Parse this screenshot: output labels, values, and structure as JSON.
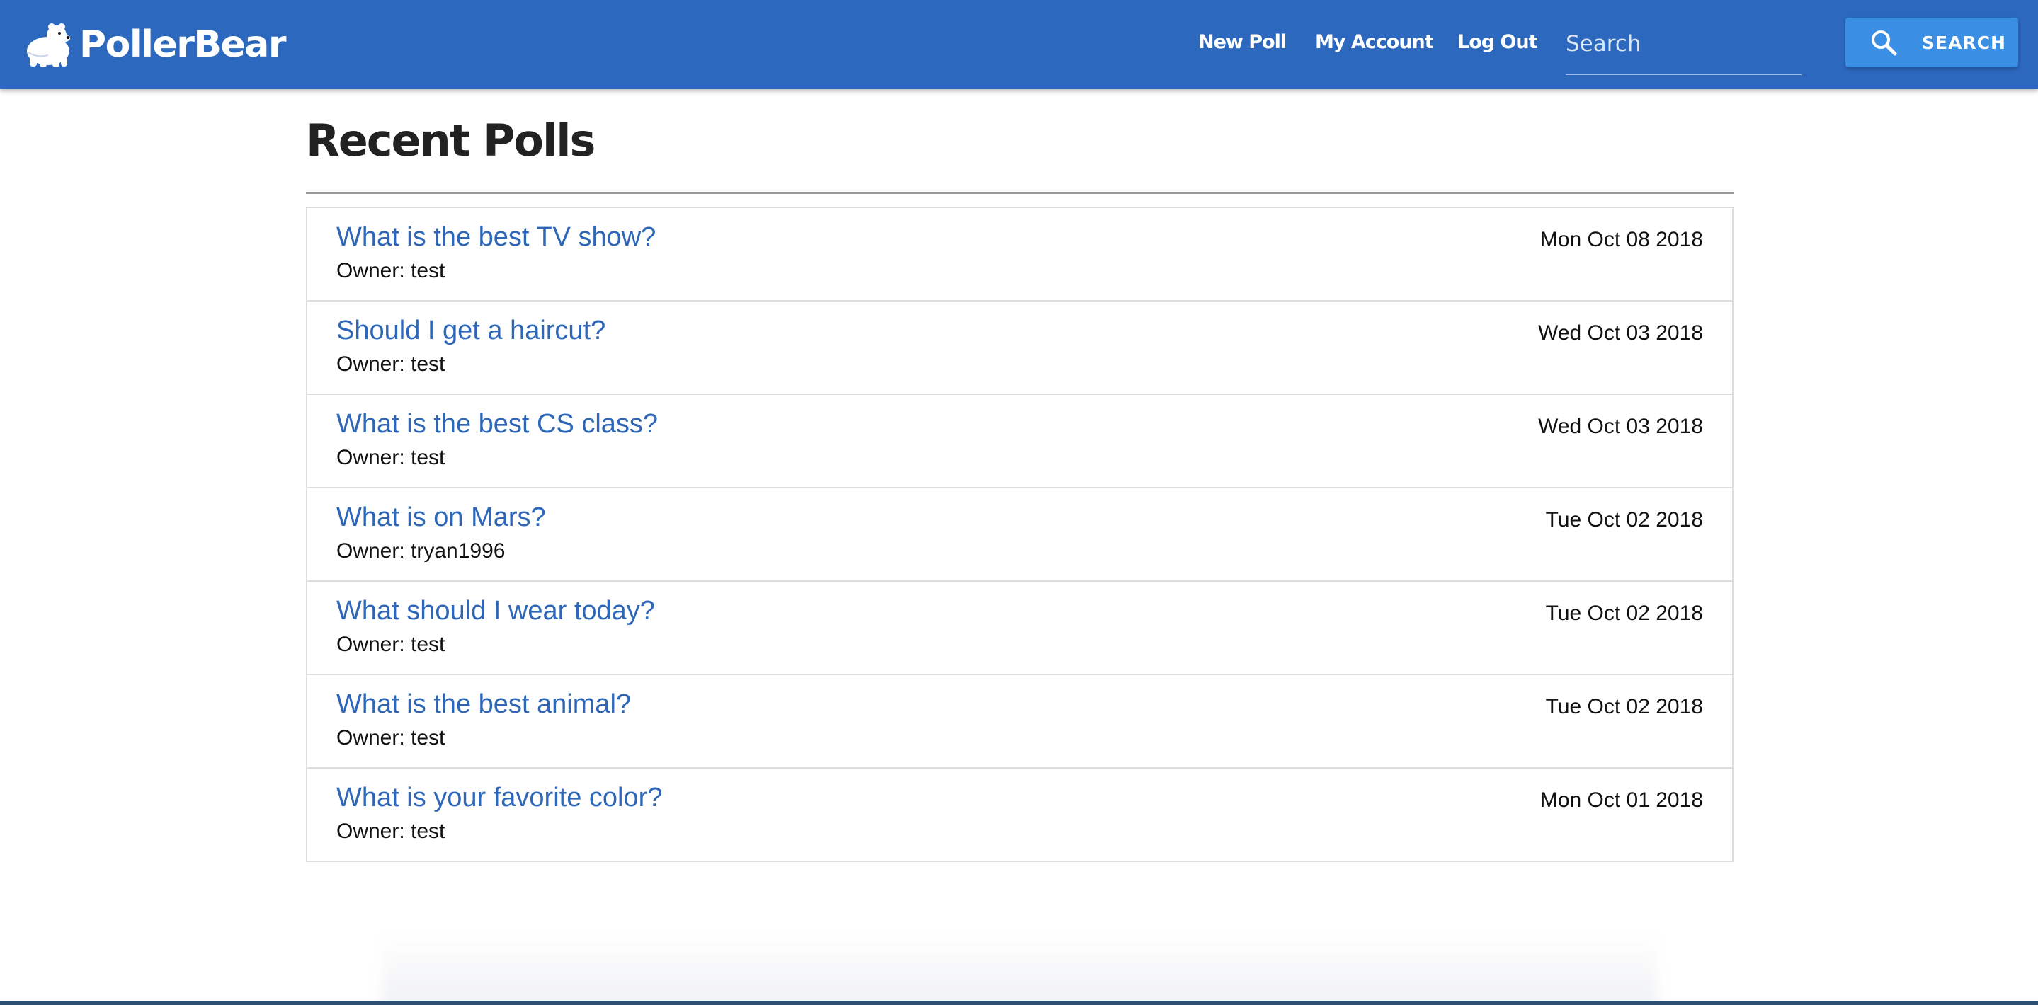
{
  "brand": {
    "name": "PollerBear",
    "logo_icon": "polar-bear-icon"
  },
  "nav": {
    "new_poll": "New Poll",
    "my_account": "My Account",
    "log_out": "Log Out"
  },
  "search": {
    "placeholder": "Search",
    "value": "",
    "button_label": "SEARCH",
    "button_icon": "search-icon"
  },
  "main": {
    "title": "Recent Polls",
    "polls": [
      {
        "question": "What is the best TV show?",
        "owner": "Owner: test",
        "date": "Mon Oct 08 2018"
      },
      {
        "question": "Should I get a haircut?",
        "owner": "Owner: test",
        "date": "Wed Oct 03 2018"
      },
      {
        "question": "What is the best CS class?",
        "owner": "Owner: test",
        "date": "Wed Oct 03 2018"
      },
      {
        "question": "What is on Mars?",
        "owner": "Owner: tryan1996",
        "date": "Tue Oct 02 2018"
      },
      {
        "question": "What should I wear today?",
        "owner": "Owner: test",
        "date": "Tue Oct 02 2018"
      },
      {
        "question": "What is the best animal?",
        "owner": "Owner: test",
        "date": "Tue Oct 02 2018"
      },
      {
        "question": "What is your favorite color?",
        "owner": "Owner: test",
        "date": "Mon Oct 01 2018"
      }
    ]
  },
  "colors": {
    "navbar": "#2c68bd",
    "search_button": "#3a8ee4",
    "link": "#2e66b8"
  }
}
